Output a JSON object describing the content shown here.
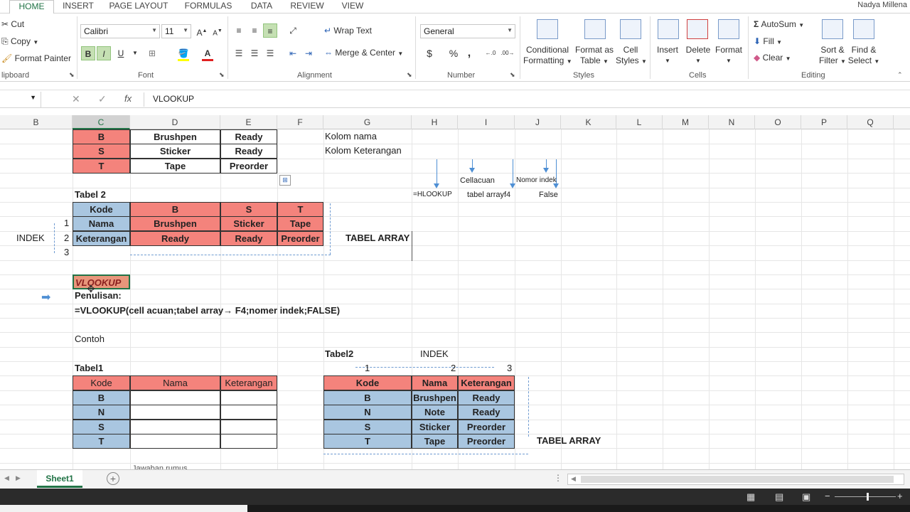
{
  "ribbon_tabs": [
    "HOME",
    "INSERT",
    "PAGE LAYOUT",
    "FORMULAS",
    "DATA",
    "REVIEW",
    "VIEW"
  ],
  "user_name": "Nadya Millena",
  "clipboard": {
    "cut": "Cut",
    "copy": "Copy",
    "format_painter": "Format Painter",
    "group": "lipboard"
  },
  "font": {
    "name": "Calibri",
    "size": "11",
    "bold": "B",
    "italic": "I",
    "underline": "U",
    "group": "Font"
  },
  "alignment": {
    "wrap": "Wrap Text",
    "merge": "Merge & Center",
    "group": "Alignment"
  },
  "number": {
    "format": "General",
    "currency": "$",
    "percent": "%",
    "comma": ",",
    "group": "Number"
  },
  "styles": {
    "cond1": "Conditional",
    "cond2": "Formatting",
    "table1": "Format as",
    "table2": "Table",
    "cell1": "Cell",
    "cell2": "Styles",
    "group": "Styles"
  },
  "cells": {
    "insert": "Insert",
    "delete": "Delete",
    "format": "Format",
    "group": "Cells"
  },
  "editing": {
    "autosum": "AutoSum",
    "fill": "Fill",
    "clear": "Clear",
    "sort1": "Sort &",
    "sort2": "Filter",
    "find1": "Find &",
    "find2": "Select",
    "group": "Editing"
  },
  "formula_bar": {
    "fx": "fx",
    "value": "VLOOKUP"
  },
  "columns": [
    "B",
    "C",
    "D",
    "E",
    "F",
    "G",
    "H",
    "I",
    "J",
    "K",
    "L",
    "M",
    "N",
    "O",
    "P",
    "Q"
  ],
  "sheet": {
    "t1_rows": [
      [
        "B",
        "Brushpen",
        "Ready"
      ],
      [
        "S",
        "Sticker",
        "Ready"
      ],
      [
        "T",
        "Tape",
        "Preorder"
      ]
    ],
    "kolom_nama": "Kolom nama",
    "kolom_ket": "Kolom Keterangan",
    "cellacuan": "Cellacuan",
    "nomor_indek": "Nomor indek",
    "hlookup": "=HLOOKUP",
    "tabel_arrayf4": "tabel arrayf4",
    "false": "False",
    "tabel2_title": "Tabel 2",
    "t2_head": [
      "Kode",
      "B",
      "S",
      "T"
    ],
    "t2_r1": [
      "Nama",
      "Brushpen",
      "Sticker",
      "Tape"
    ],
    "t2_r2": [
      "Keterangan",
      "Ready",
      "Ready",
      "Preorder"
    ],
    "indek": "INDEK",
    "idx": [
      "1",
      "2",
      "3"
    ],
    "tabel_array": "TABEL ARRAY",
    "vlookup": "VLOOKUP",
    "penulisan": "Penulisan:",
    "syntax": "=VLOOKUP(cell acuan;tabel array→ F4;nomer indek;FALSE)",
    "contoh": "Contoh",
    "tabel2b": "Tabel2",
    "indek2": "INDEK",
    "tabel1": "Tabel1",
    "t3_head": [
      "Kode",
      "Nama",
      "Keterangan"
    ],
    "t3_codes": [
      "B",
      "N",
      "S",
      "T"
    ],
    "t4_head": [
      "Kode",
      "Nama",
      "Keterangan"
    ],
    "t4_rows": [
      [
        "B",
        "Brushpen",
        "Ready"
      ],
      [
        "N",
        "Note",
        "Ready"
      ],
      [
        "S",
        "Sticker",
        "Preorder"
      ],
      [
        "T",
        "Tape",
        "Preorder"
      ]
    ],
    "idx2": [
      "1",
      "2",
      "3"
    ],
    "tabel_array2": "TABEL ARRAY",
    "partial": "Jawaban rumus"
  },
  "sheet_tab": "Sheet1",
  "colors": {
    "green": "#217346",
    "red_fill": "#f4837c",
    "blue_fill": "#a9c6e0"
  }
}
